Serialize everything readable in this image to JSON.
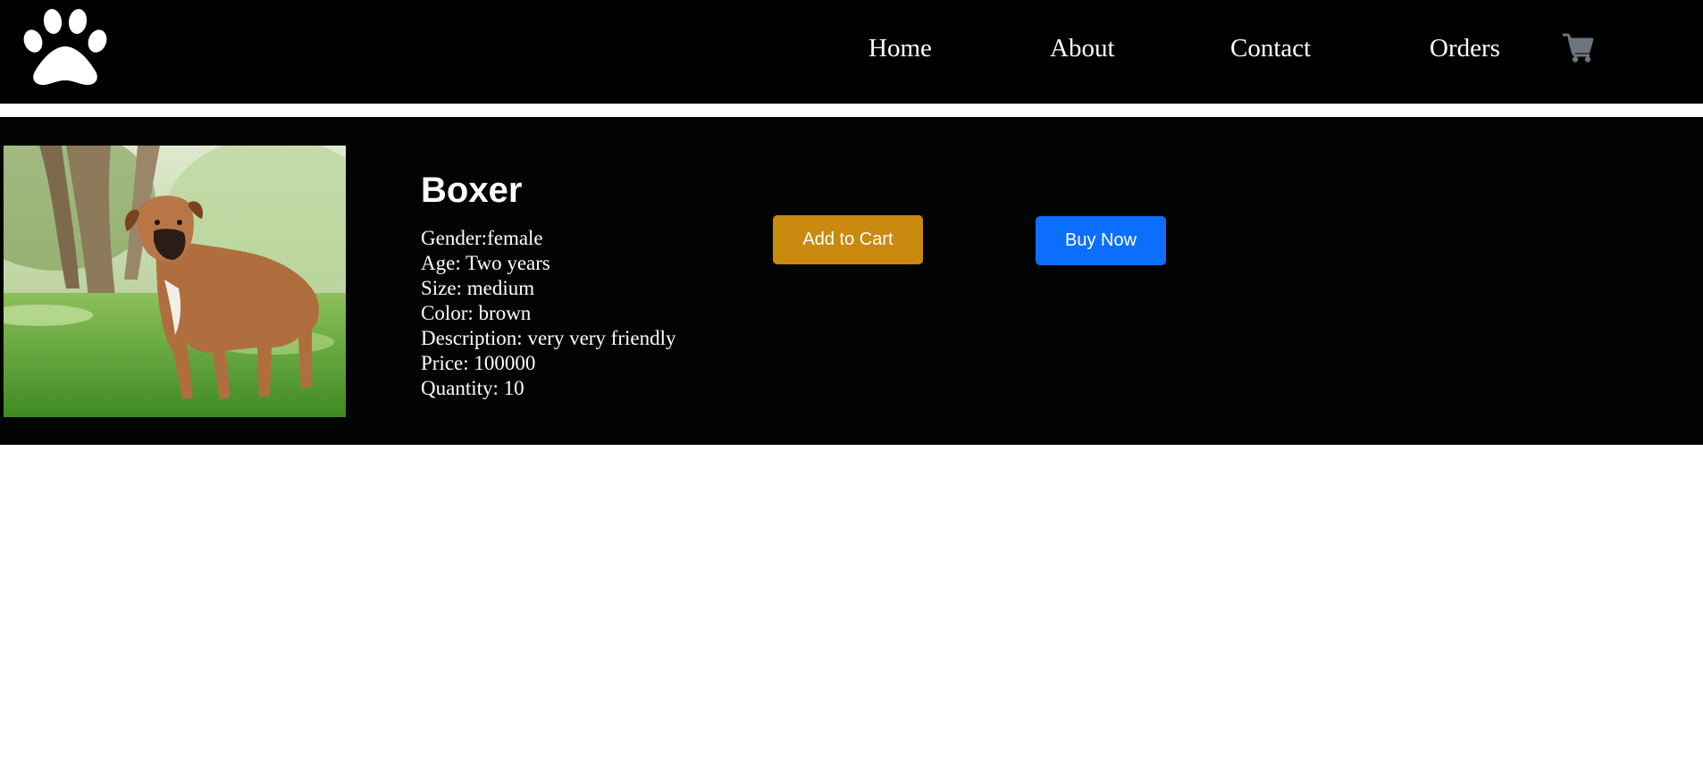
{
  "nav": {
    "links": [
      {
        "label": "Home"
      },
      {
        "label": "About"
      },
      {
        "label": "Contact"
      },
      {
        "label": "Orders"
      }
    ],
    "logo_icon": "paw-icon",
    "cart_icon": "shopping-cart-icon"
  },
  "product": {
    "name": "Boxer",
    "image_icon": "boxer-dog-photo",
    "details": {
      "gender": "Gender:female",
      "age": "Age: Two years",
      "size": "Size: medium",
      "color": "Color: brown",
      "description": "Description: very very friendly",
      "price": "Price: 100000",
      "quantity": "Quantity: 10"
    },
    "add_to_cart_label": "Add to Cart",
    "buy_now_label": "Buy Now"
  },
  "colors": {
    "navbar_bg": "#000000",
    "band_bg": "#020402",
    "add_to_cart": "#c98a0f",
    "buy_now": "#0c6efd",
    "cart_icon": "#6c757d"
  }
}
